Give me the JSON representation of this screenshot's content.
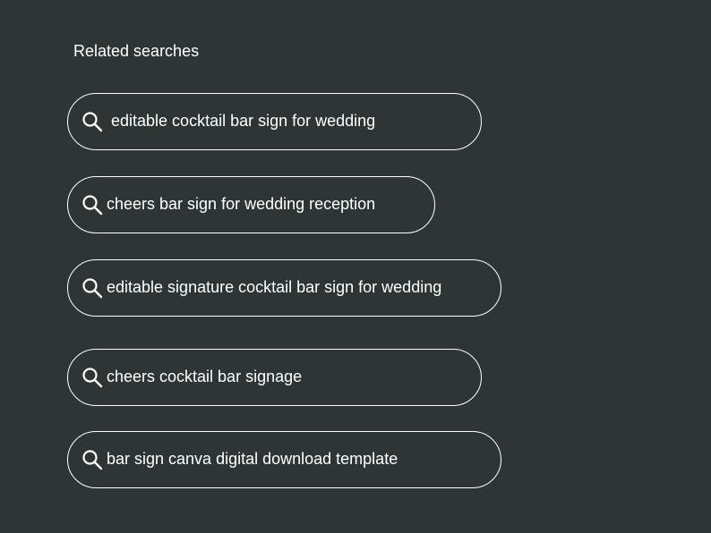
{
  "related": {
    "title": "Related searches",
    "items": [
      {
        "label": "editable cocktail bar sign for wedding",
        "icon": "search-icon"
      },
      {
        "label": "cheers bar sign for wedding reception",
        "icon": "search-icon"
      },
      {
        "label": "editable signature cocktail bar sign for wedding",
        "icon": "search-icon"
      },
      {
        "label": "cheers cocktail bar signage",
        "icon": "search-icon"
      },
      {
        "label": "bar sign canva digital download template",
        "icon": "search-icon"
      }
    ]
  },
  "colors": {
    "background": "#2f3535",
    "text": "#ffffff",
    "border": "#ffffff"
  }
}
